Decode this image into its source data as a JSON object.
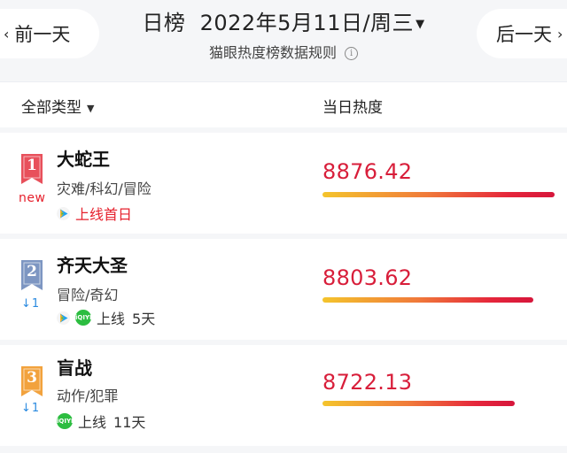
{
  "header": {
    "prev_label": "前一天",
    "next_label": "后一天",
    "title_prefix": "日榜",
    "date": "2022年5月11日/周三",
    "rules_text": "猫眼热度榜数据规则",
    "info_icon": "info-icon",
    "chevron_left": "‹",
    "chevron_right": "›",
    "caret": "▼"
  },
  "columns": {
    "type_label": "全部类型",
    "heat_label": "当日热度"
  },
  "rows": [
    {
      "rank": "1",
      "badge_color": "#e8505b",
      "status": "new",
      "title": "大蛇王",
      "genre": "灾难/科幻/冒险",
      "platforms": [
        "tencent-video-icon"
      ],
      "release_text": "上线首日",
      "release_days": "",
      "heat": "8876.42",
      "heat_fraction": 1.0
    },
    {
      "rank": "2",
      "badge_color": "#7d96c2",
      "change_arrow": "↓",
      "change": "1",
      "title": "齐天大圣",
      "genre": "冒险/奇幻",
      "platforms": [
        "tencent-video-icon",
        "iqiyi-icon"
      ],
      "release_text": "上线",
      "release_days": "5天",
      "heat": "8803.62",
      "heat_fraction": 0.91
    },
    {
      "rank": "3",
      "badge_color": "#f2a23d",
      "change_arrow": "↓",
      "change": "1",
      "title": "盲战",
      "genre": "动作/犯罪",
      "platforms": [
        "iqiyi-icon"
      ],
      "release_text": "上线",
      "release_days": "11天",
      "heat": "8722.13",
      "heat_fraction": 0.83
    }
  ],
  "iqiyi_glyph": "iQIYI",
  "colors": {
    "accent": "#e6202c",
    "heat_text": "#d81e3a",
    "change": "#2a8ae0",
    "iqiyi": "#2cbd40"
  }
}
